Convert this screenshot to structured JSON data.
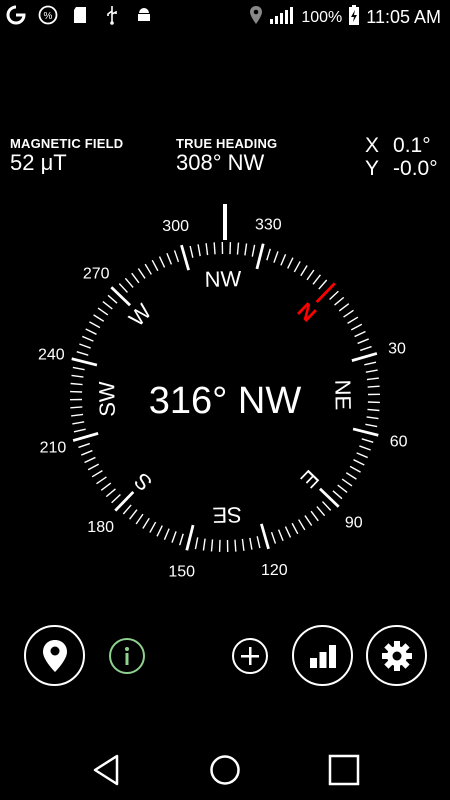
{
  "status_bar": {
    "left_icons": [
      "g-logo-icon",
      "percent-icon",
      "sd-card-icon",
      "usb-icon",
      "android-debug-icon"
    ],
    "battery_percent": "100%",
    "time": "11:05 AM"
  },
  "magnetic_field": {
    "label": "MAGNETIC FIELD",
    "value": "52 μT"
  },
  "true_heading": {
    "label": "TRUE HEADING",
    "value": "308° NW"
  },
  "tilt": {
    "x_label": "X",
    "x_value": "0.1°",
    "y_label": "Y",
    "y_value": "-0.0°"
  },
  "compass": {
    "heading_readout": "316° NW",
    "heading_degrees": 316,
    "degree_labels": [
      "30",
      "60",
      "90",
      "120",
      "150",
      "180",
      "210",
      "240",
      "270",
      "300",
      "330"
    ],
    "cardinals": {
      "N": "N",
      "NE": "NE",
      "E": "E",
      "SE": "SE",
      "S": "S",
      "SW": "SW",
      "W": "W",
      "NW": "NW"
    },
    "north_color": "#ff0000"
  },
  "buttons": [
    "location-button",
    "info-button",
    "add-button",
    "stats-button",
    "settings-button"
  ],
  "colors": {
    "background": "#000000",
    "foreground": "#ffffff",
    "north": "#ff0000",
    "info_accent": "#8fd18f"
  }
}
